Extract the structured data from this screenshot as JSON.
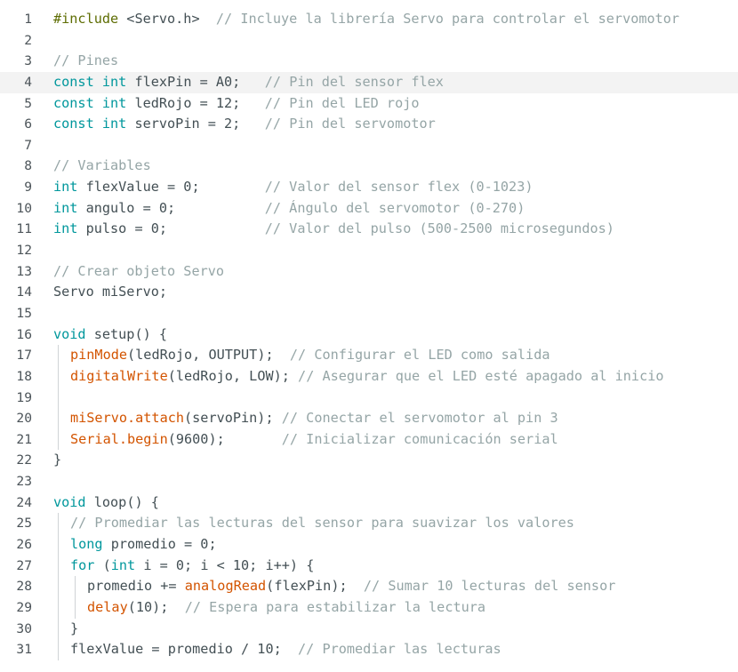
{
  "editor": {
    "current_line": 4,
    "colors": {
      "comment": "#95a5a6",
      "keyword": "#00979c",
      "function": "#d35400",
      "directive": "#5e6d03",
      "text": "#434f54",
      "current_line_bg": "#f3f3f3"
    },
    "lines": [
      {
        "n": "1",
        "indent": 0,
        "tokens": [
          [
            "dir",
            "#include"
          ],
          [
            "txt",
            " <Servo.h>  "
          ],
          [
            "cmt",
            "// Incluye la librería Servo para controlar el servomotor"
          ]
        ]
      },
      {
        "n": "2",
        "indent": 0,
        "tokens": []
      },
      {
        "n": "3",
        "indent": 0,
        "tokens": [
          [
            "cmt",
            "// Pines"
          ]
        ]
      },
      {
        "n": "4",
        "indent": 0,
        "tokens": [
          [
            "kw",
            "const"
          ],
          [
            "txt",
            " "
          ],
          [
            "kw",
            "int"
          ],
          [
            "txt",
            " flexPin = A0;   "
          ],
          [
            "cmt",
            "// Pin del sensor flex"
          ]
        ]
      },
      {
        "n": "5",
        "indent": 0,
        "tokens": [
          [
            "kw",
            "const"
          ],
          [
            "txt",
            " "
          ],
          [
            "kw",
            "int"
          ],
          [
            "txt",
            " ledRojo = 12;   "
          ],
          [
            "cmt",
            "// Pin del LED rojo"
          ]
        ]
      },
      {
        "n": "6",
        "indent": 0,
        "tokens": [
          [
            "kw",
            "const"
          ],
          [
            "txt",
            " "
          ],
          [
            "kw",
            "int"
          ],
          [
            "txt",
            " servoPin = 2;   "
          ],
          [
            "cmt",
            "// Pin del servomotor"
          ]
        ]
      },
      {
        "n": "7",
        "indent": 0,
        "tokens": []
      },
      {
        "n": "8",
        "indent": 0,
        "tokens": [
          [
            "cmt",
            "// Variables"
          ]
        ]
      },
      {
        "n": "9",
        "indent": 0,
        "tokens": [
          [
            "kw",
            "int"
          ],
          [
            "txt",
            " flexValue = 0;        "
          ],
          [
            "cmt",
            "// Valor del sensor flex (0-1023)"
          ]
        ]
      },
      {
        "n": "10",
        "indent": 0,
        "tokens": [
          [
            "kw",
            "int"
          ],
          [
            "txt",
            " angulo = 0;           "
          ],
          [
            "cmt",
            "// Ángulo del servomotor (0-270)"
          ]
        ]
      },
      {
        "n": "11",
        "indent": 0,
        "tokens": [
          [
            "kw",
            "int"
          ],
          [
            "txt",
            " pulso = 0;            "
          ],
          [
            "cmt",
            "// Valor del pulso (500-2500 microsegundos)"
          ]
        ]
      },
      {
        "n": "12",
        "indent": 0,
        "tokens": []
      },
      {
        "n": "13",
        "indent": 0,
        "tokens": [
          [
            "cmt",
            "// Crear objeto Servo"
          ]
        ]
      },
      {
        "n": "14",
        "indent": 0,
        "tokens": [
          [
            "cls",
            "Servo"
          ],
          [
            "txt",
            " miServo;"
          ]
        ]
      },
      {
        "n": "15",
        "indent": 0,
        "tokens": []
      },
      {
        "n": "16",
        "indent": 0,
        "tokens": [
          [
            "kw",
            "void"
          ],
          [
            "txt",
            " "
          ],
          [
            "cls",
            "setup"
          ],
          [
            "txt",
            "() {"
          ]
        ]
      },
      {
        "n": "17",
        "indent": 1,
        "tokens": [
          [
            "fn",
            "pinMode"
          ],
          [
            "txt",
            "(ledRojo, OUTPUT);  "
          ],
          [
            "cmt",
            "// Configurar el LED como salida"
          ]
        ]
      },
      {
        "n": "18",
        "indent": 1,
        "tokens": [
          [
            "fn",
            "digitalWrite"
          ],
          [
            "txt",
            "(ledRojo, LOW); "
          ],
          [
            "cmt",
            "// Asegurar que el LED esté apagado al inicio"
          ]
        ]
      },
      {
        "n": "19",
        "indent": 1,
        "tokens": []
      },
      {
        "n": "20",
        "indent": 1,
        "tokens": [
          [
            "fn",
            "miServo.attach"
          ],
          [
            "txt",
            "(servoPin); "
          ],
          [
            "cmt",
            "// Conectar el servomotor al pin 3"
          ]
        ]
      },
      {
        "n": "21",
        "indent": 1,
        "tokens": [
          [
            "fn",
            "Serial.begin"
          ],
          [
            "txt",
            "(9600);       "
          ],
          [
            "cmt",
            "// Inicializar comunicación serial"
          ]
        ]
      },
      {
        "n": "22",
        "indent": 0,
        "tokens": [
          [
            "txt",
            "}"
          ]
        ]
      },
      {
        "n": "23",
        "indent": 0,
        "tokens": []
      },
      {
        "n": "24",
        "indent": 0,
        "tokens": [
          [
            "kw",
            "void"
          ],
          [
            "txt",
            " "
          ],
          [
            "cls",
            "loop"
          ],
          [
            "txt",
            "() {"
          ]
        ]
      },
      {
        "n": "25",
        "indent": 1,
        "tokens": [
          [
            "cmt",
            "// Promediar las lecturas del sensor para suavizar los valores"
          ]
        ]
      },
      {
        "n": "26",
        "indent": 1,
        "tokens": [
          [
            "kw",
            "long"
          ],
          [
            "txt",
            " promedio = 0;"
          ]
        ]
      },
      {
        "n": "27",
        "indent": 1,
        "tokens": [
          [
            "kw",
            "for"
          ],
          [
            "txt",
            " ("
          ],
          [
            "kw",
            "int"
          ],
          [
            "txt",
            " i = 0; i < 10; i++) {"
          ]
        ]
      },
      {
        "n": "28",
        "indent": 2,
        "tokens": [
          [
            "txt",
            "promedio += "
          ],
          [
            "fn",
            "analogRead"
          ],
          [
            "txt",
            "(flexPin);  "
          ],
          [
            "cmt",
            "// Sumar 10 lecturas del sensor"
          ]
        ]
      },
      {
        "n": "29",
        "indent": 2,
        "tokens": [
          [
            "fn",
            "delay"
          ],
          [
            "txt",
            "(10);  "
          ],
          [
            "cmt",
            "// Espera para estabilizar la lectura"
          ]
        ]
      },
      {
        "n": "30",
        "indent": 1,
        "tokens": [
          [
            "txt",
            "}"
          ]
        ]
      },
      {
        "n": "31",
        "indent": 1,
        "tokens": [
          [
            "txt",
            "flexValue = promedio / 10;  "
          ],
          [
            "cmt",
            "// Promediar las lecturas"
          ]
        ]
      }
    ]
  }
}
